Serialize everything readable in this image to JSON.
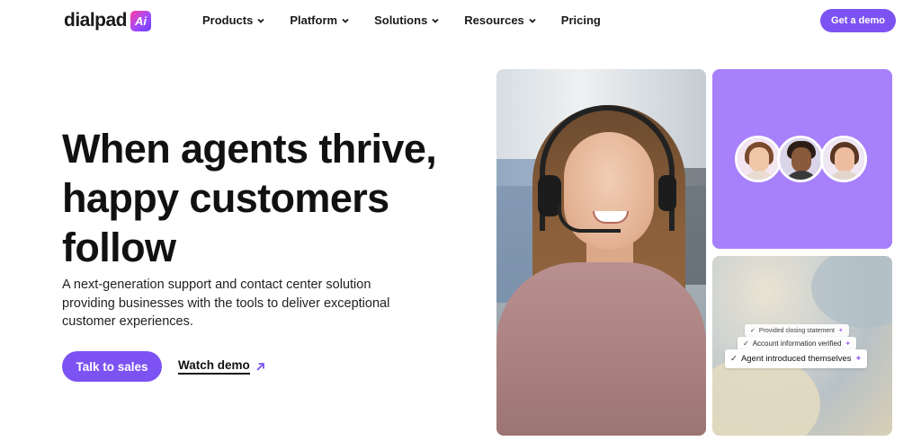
{
  "nav": {
    "logo_text": "dialpad",
    "logo_mark": "Ai",
    "items": [
      {
        "label": "Products",
        "has_dropdown": true
      },
      {
        "label": "Platform",
        "has_dropdown": true
      },
      {
        "label": "Solutions",
        "has_dropdown": true
      },
      {
        "label": "Resources",
        "has_dropdown": true
      },
      {
        "label": "Pricing",
        "has_dropdown": false
      }
    ],
    "cta_label": "Get a demo"
  },
  "hero": {
    "headline": "When agents thrive, happy customers follow",
    "subcopy": "A next-generation support and contact center solution providing businesses with the tools to deliver exceptional customer experiences.",
    "primary_cta": "Talk to sales",
    "secondary_cta": "Watch demo",
    "secondary_cta_icon": "arrow-up-right-icon"
  },
  "checklist": {
    "items": [
      "Provided closing statement",
      "Account information verified",
      "Agent introduced themselves"
    ],
    "check_icon": "check-icon",
    "ai_icon": "sparkle-icon"
  },
  "colors": {
    "brand_purple": "#7c52f2",
    "panel_purple": "#a780fb",
    "text_dark": "#111111"
  }
}
